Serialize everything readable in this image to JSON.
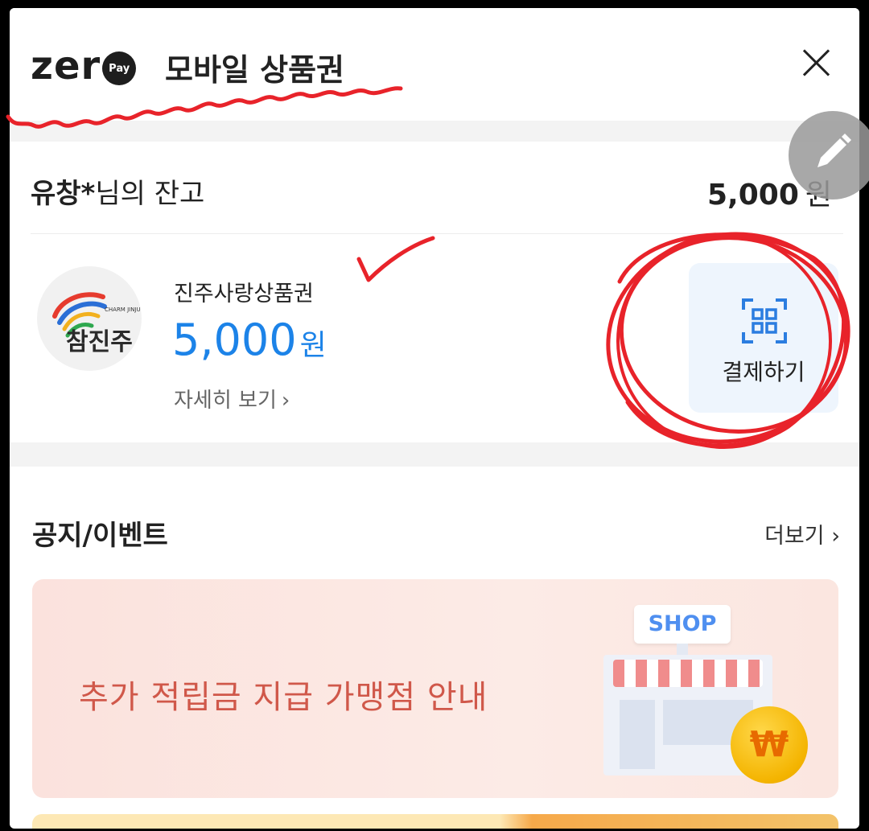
{
  "header": {
    "logo_text": "zer",
    "logo_badge": "Pay",
    "title": "모바일 상품권",
    "close_icon": "close-icon"
  },
  "balance": {
    "owner_bold": "유창*",
    "owner_suffix": "님의 잔고",
    "amount": "5,000",
    "unit": "원"
  },
  "voucher": {
    "name": "진주사랑상품권",
    "amount": "5,000",
    "unit": "원",
    "detail_link": "자세히 보기",
    "logo_text_main": "참진주",
    "logo_text_small": "CHARM JINJU",
    "pay_button": "결제하기"
  },
  "notice": {
    "title": "공지/이벤트",
    "more": "더보기",
    "banner_text": "추가 적립금 지급 가맹점 안내",
    "shop_sign": "SHOP",
    "coin_symbol": "₩"
  },
  "colors": {
    "accent_blue": "#1c83e8",
    "banner_text": "#d0584a",
    "annotation_red": "#e8232a"
  }
}
